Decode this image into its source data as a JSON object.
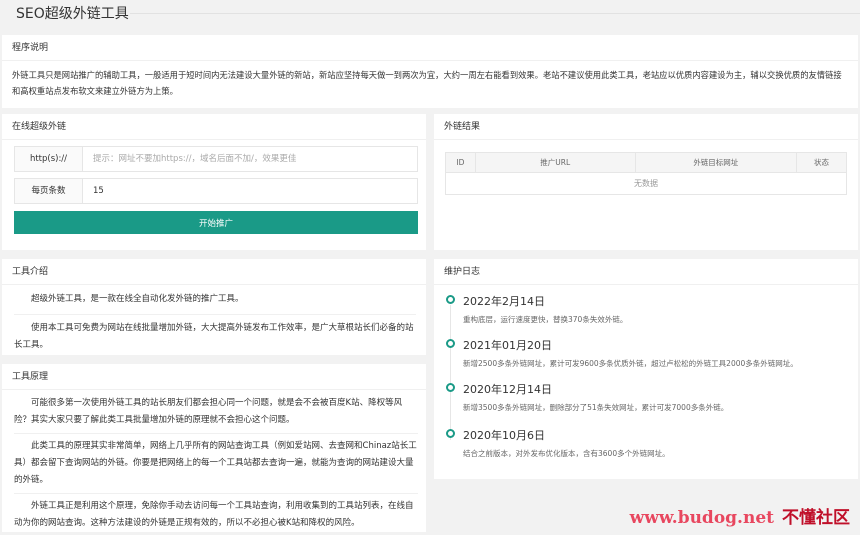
{
  "page_title": "SEO超级外链工具",
  "intro": {
    "title": "程序说明",
    "text": "外链工具只是网站推广的辅助工具，一般适用于短时间内无法建设大量外链的新站，新站应坚持每天做一到两次为宜，大约一周左右能看到效果。老站不建议使用此类工具，老站应以优质内容建设为主，辅以交换优质的友情链接和高权重站点发布软文来建立外链方为上策。"
  },
  "online": {
    "title": "在线超级外链",
    "url_label": "http(s)://",
    "url_placeholder": "提示：网址不要加https://，域名后面不加/，效果更佳",
    "count_label": "每页条数",
    "count_value": "15",
    "submit_label": "开始推广"
  },
  "results": {
    "title": "外链结果",
    "columns": [
      "ID",
      "推广URL",
      "外链目标网址",
      "状态"
    ],
    "empty_text": "无数据"
  },
  "tool_intro": {
    "title": "工具介绍",
    "paragraphs": [
      "超级外链工具，是一款在线全自动化发外链的推广工具。",
      "使用本工具可免费为网站在线批量增加外链，大大提高外链发布工作效率，是广大草根站长们必备的站长工具。"
    ]
  },
  "principle": {
    "title": "工具原理",
    "paragraphs": [
      "可能很多第一次使用外链工具的站长朋友们都会担心同一个问题，就是会不会被百度K站、降权等风险？其实大家只要了解此类工具批量增加外链的原理就不会担心这个问题。",
      "此类工具的原理其实非常简单，网络上几乎所有的网站查询工具（例如爱站网、去查网和Chinaz站长工具）都会留下查询网站的外链。你要是把网络上的每一个工具站都去查询一遍，就能为查询的网站建设大量的外链。",
      "外链工具正是利用这个原理，免除你手动去访问每一个工具站查询，利用收集到的工具站列表，在线自动为你的网站查询。这种方法建设的外链是正规有效的，所以不必担心被K站和降权的风险。"
    ]
  },
  "changelog": {
    "title": "维护日志",
    "entries": [
      {
        "date": "2022年2月14日",
        "desc": "重构底层，运行速度更快，替换370条失效外链。"
      },
      {
        "date": "2021年01月20日",
        "desc": "新增2500多条外链网址，累计可发9600多条优质外链，超过卢松松的外链工具2000多条外链网址。"
      },
      {
        "date": "2020年12月14日",
        "desc": "新增3500多条外链网址，删除部分了51条失效网址，累计可发7000多条外链。"
      },
      {
        "date": "2020年10月6日",
        "desc": "结合之前版本，对外发布优化版本，含有3600多个外链网址。"
      }
    ]
  },
  "watermark": {
    "site": "www.budog.net",
    "name": "不懂社区"
  },
  "colors": {
    "accent": "#1a9a87",
    "watermark": "#e8475f"
  }
}
